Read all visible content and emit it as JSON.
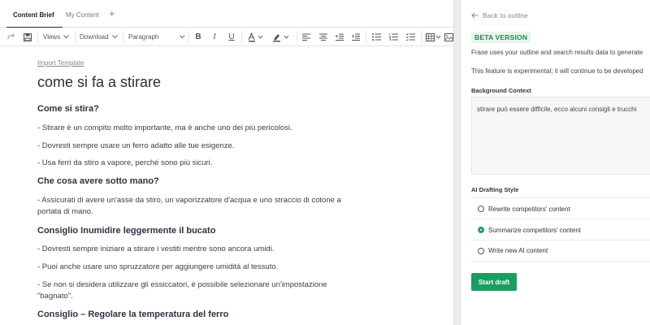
{
  "tabs": [
    {
      "label": "Content Brief",
      "active": true
    },
    {
      "label": "My Content",
      "active": false
    }
  ],
  "toolbar": {
    "views_label": "Views",
    "download_label": "Download",
    "paragraph_label": "Paragraph"
  },
  "document": {
    "import_template": "Import Template",
    "title": "come si fa a stirare",
    "blocks": [
      {
        "type": "h2",
        "text": "Come si stira?"
      },
      {
        "type": "p",
        "text": "- Stirare è un compito molto importante, ma è anche uno dei più pericolosi."
      },
      {
        "type": "p",
        "text": "- Dovresti sempre usare un ferro adatto alle tue esigenze."
      },
      {
        "type": "p",
        "text": "- Usa ferri da stiro a vapore, perché sono più sicuri."
      },
      {
        "type": "h2",
        "text": "Che cosa avere sotto mano?"
      },
      {
        "type": "p",
        "text": "- Assicurati di avere un'asse da stiro, un vaporizzatore d'acqua e uno straccio di cotone a portata di mano."
      },
      {
        "type": "h2",
        "text": "Consiglio Inumidire leggermente il bucato"
      },
      {
        "type": "p",
        "text": "- Dovresti sempre iniziare a stirare i vestiti mentre sono ancora umidi."
      },
      {
        "type": "p",
        "text": "- Puoi anche usare uno spruzzatore per aggiungere umidità al tessuto."
      },
      {
        "type": "p",
        "text": "- Se non si desidera utilizzare gli essiccatori, è possibile selezionare un'impostazione \"bagnato\"."
      },
      {
        "type": "h2",
        "text": "Consiglio – Regolare la temperatura del ferro"
      }
    ]
  },
  "panel": {
    "back_label": "Back to outline",
    "beta_badge": "BETA VERSION",
    "intro_1": "Frase uses your outline and search results data to generate",
    "intro_2": "This feature is experimental; it will continue to be developed",
    "background_label": "Background Context",
    "background_value": "stirare può essere difficile, ecco alcuni consigli e trucchi",
    "style_label": "AI Drafting Style",
    "options": [
      {
        "label": "Rewrite competitors' content",
        "selected": false
      },
      {
        "label": "Summarize competitors' content",
        "selected": true
      },
      {
        "label": "Write new AI content",
        "selected": false
      }
    ],
    "start_button": "Start draft"
  },
  "colors": {
    "accent_green": "#1a9e5f",
    "beta_bg": "#e7f5ec",
    "beta_text": "#1f8a4c"
  }
}
